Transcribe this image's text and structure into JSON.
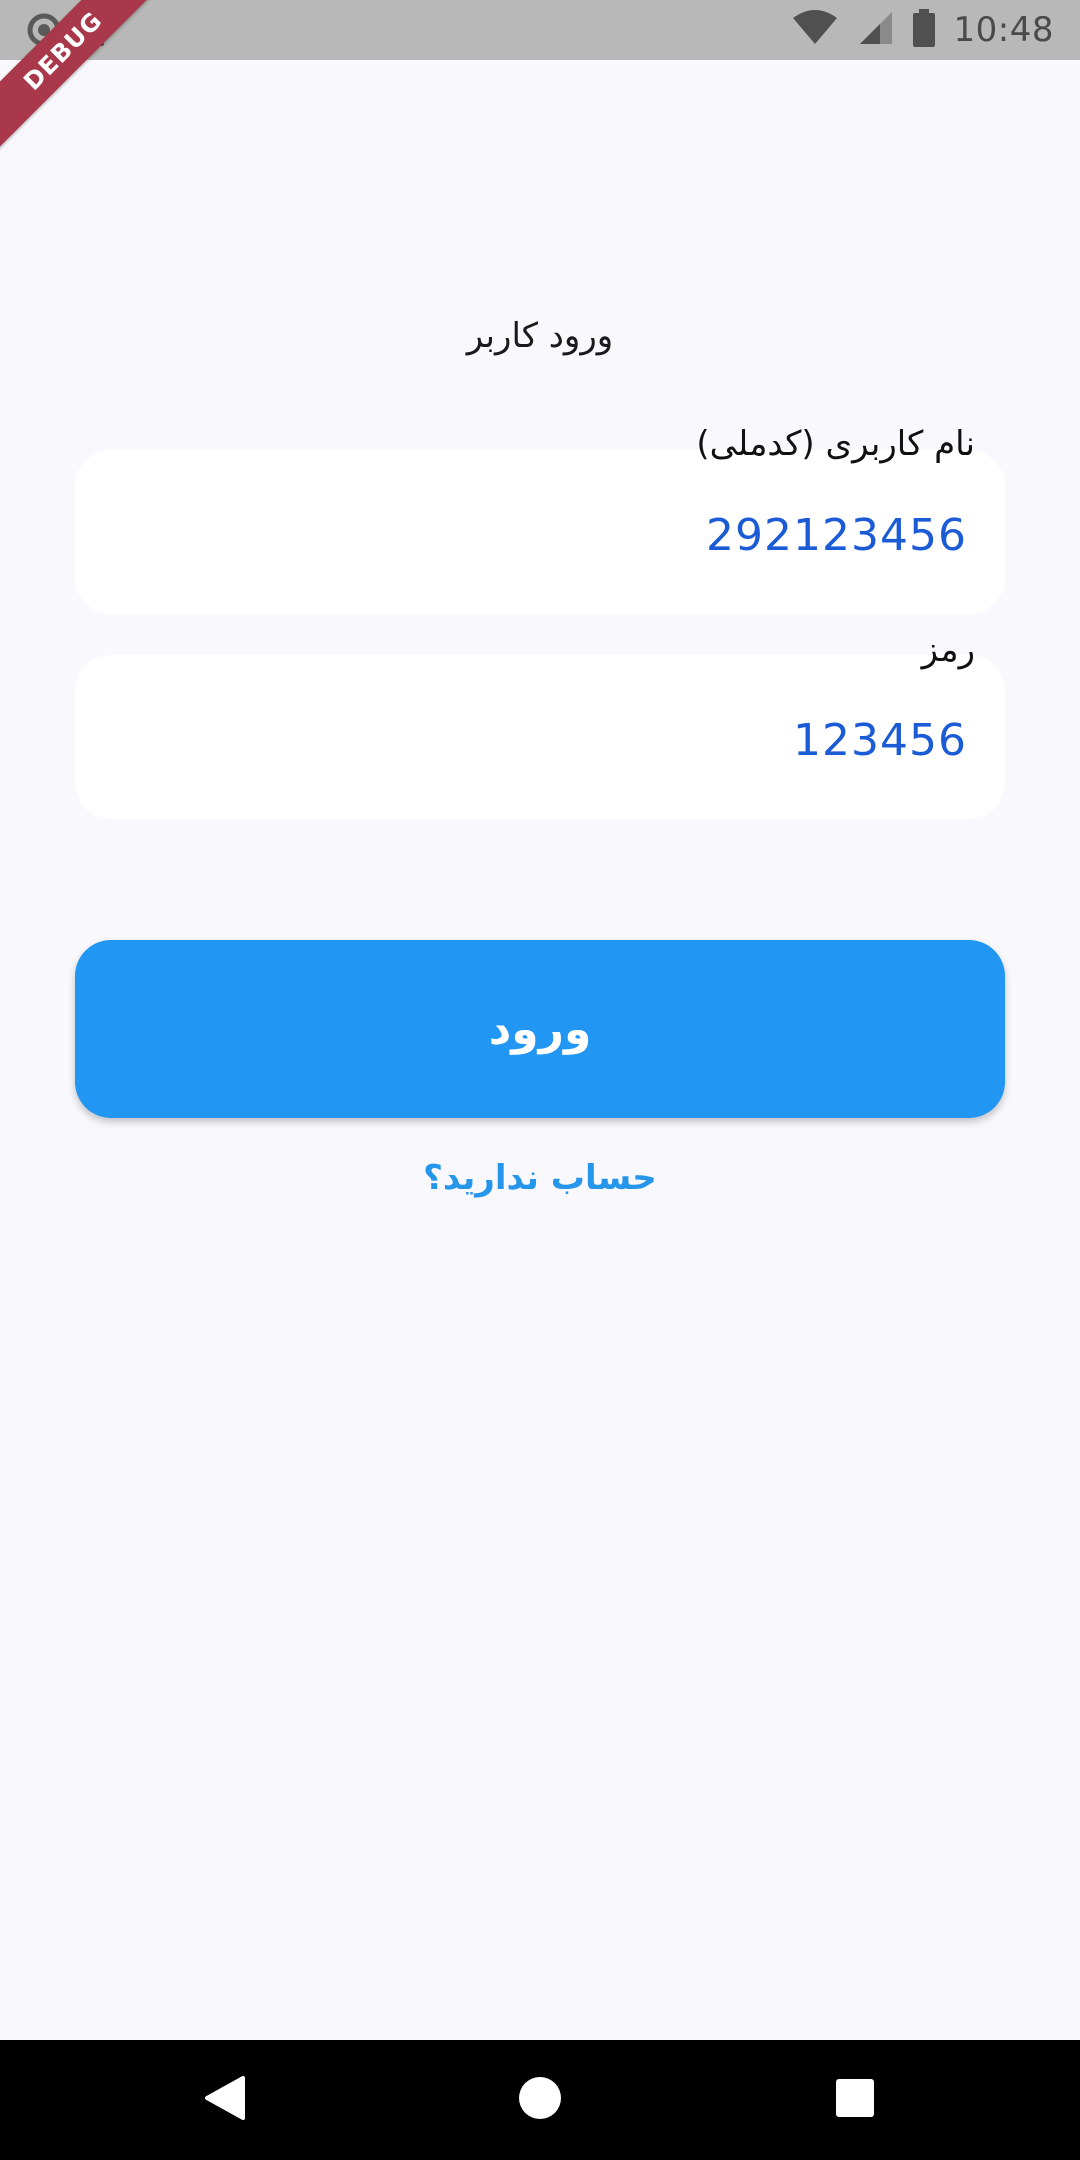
{
  "status_bar": {
    "time": "10:48",
    "icons": [
      "camera-icon",
      "sd-card-icon",
      "wifi-icon",
      "signal-icon",
      "battery-icon"
    ]
  },
  "debug_banner": {
    "label": "DEBUG",
    "color": "#a8384a"
  },
  "login": {
    "title": "ورود کاربر",
    "username": {
      "label": "نام کاربری (کدملی)",
      "value": "292123456"
    },
    "password": {
      "label": "رمز",
      "value": "123456"
    },
    "submit_label": "ورود",
    "signup_link": "حساب ندارید؟"
  },
  "nav_bar": {
    "icons": [
      "back-icon",
      "home-icon",
      "recents-icon"
    ]
  },
  "colors": {
    "background": "#f8f8fd",
    "accent": "#2196f2",
    "input_text": "#1c5bd6",
    "link": "#2596ea"
  }
}
